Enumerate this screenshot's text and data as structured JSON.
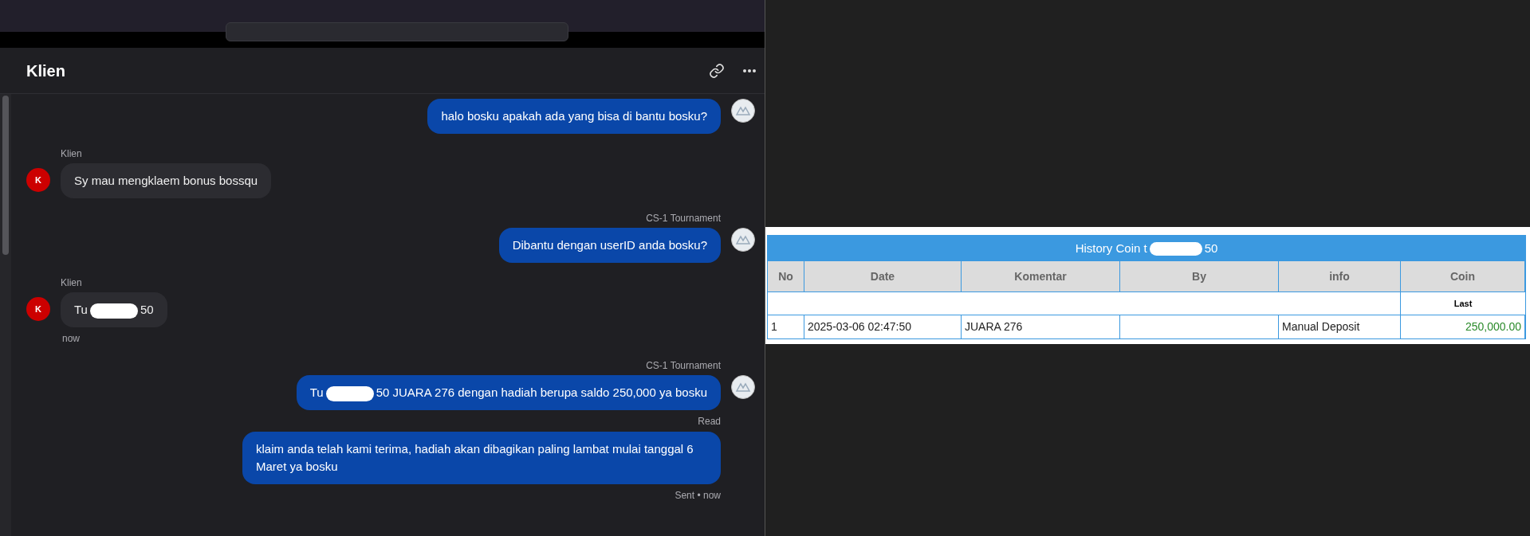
{
  "chat": {
    "title": "Klien",
    "messages": [
      {
        "kind": "outgoing",
        "show_avatar": true,
        "parts": [
          {
            "text": "halo bosku apakah ada yang bisa di bantu bosku?"
          }
        ]
      },
      {
        "kind": "incoming",
        "sender": "Klien",
        "avatar": "K",
        "show_avatar": true,
        "parts": [
          {
            "text": "Sy mau mengklaem bonus bossqu"
          }
        ]
      },
      {
        "kind": "outgoing",
        "sender": "CS-1 Tournament",
        "show_avatar": true,
        "parts": [
          {
            "text": "Dibantu dengan userID anda bosku?"
          }
        ]
      },
      {
        "kind": "incoming",
        "sender": "Klien",
        "avatar": "K",
        "show_avatar": true,
        "parts": [
          {
            "text": "Tu"
          },
          {
            "redacted": true
          },
          {
            "text": "50"
          }
        ],
        "status": "now"
      },
      {
        "kind": "outgoing",
        "sender": "CS-1 Tournament",
        "show_avatar": true,
        "parts": [
          {
            "text": "Tu"
          },
          {
            "redacted": true
          },
          {
            "text": "50 JUARA 276 dengan hadiah berupa saldo 250,000 ya bosku"
          }
        ],
        "status": "Read"
      },
      {
        "kind": "outgoing",
        "show_avatar": false,
        "parts": [
          {
            "text": "klaim anda telah kami terima, hadiah akan dibagikan paling lambat mulai tanggal 6 Maret ya bosku"
          }
        ],
        "status": "Sent • now"
      }
    ]
  },
  "history": {
    "title_before": "History Coin t",
    "title_after": "50",
    "columns": [
      "No",
      "Date",
      "Komentar",
      "By",
      "info",
      "Coin"
    ],
    "last_label": "Last",
    "rows": [
      [
        "1",
        "2025-03-06 02:47:50",
        "JUARA 276",
        "",
        "Manual Deposit",
        "250,000.00"
      ]
    ]
  }
}
